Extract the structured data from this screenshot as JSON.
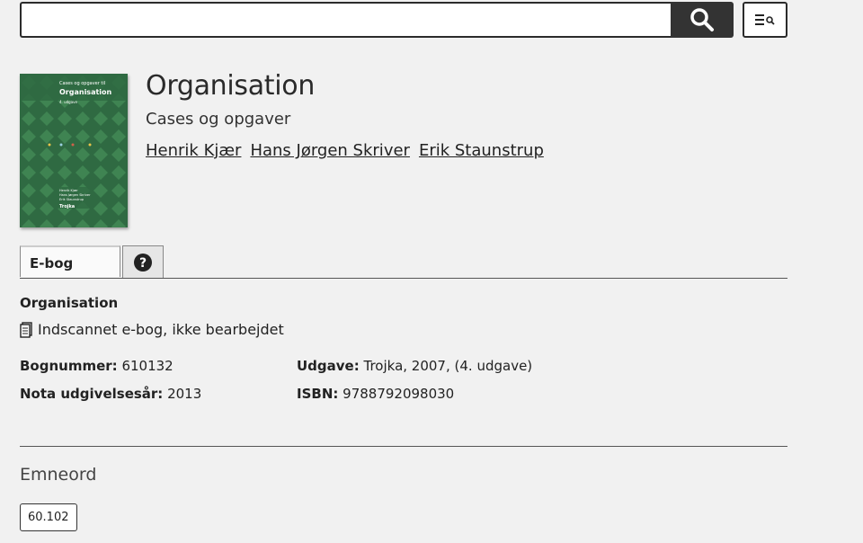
{
  "search": {
    "value": "",
    "placeholder": "",
    "icon": "search-icon",
    "advanced_icon": "advanced-search-icon"
  },
  "book": {
    "title": "Organisation",
    "subtitle": "Cases og opgaver",
    "authors": [
      "Henrik Kjær",
      "Hans Jørgen Skriver",
      "Erik Staunstrup"
    ],
    "cover": {
      "line1": "Cases og opgaver til",
      "line2": "Organisation",
      "line3": "4. udgave",
      "authors_small": [
        "Henrik Kjær",
        "Hans Jørgen Skriver",
        "Erik Staunstrup"
      ],
      "publisher": "Trojka",
      "color": "#2f6a42"
    }
  },
  "tabs": [
    {
      "label": "E-bog",
      "active": true
    },
    {
      "label": "?",
      "icon": "help-icon",
      "active": false
    }
  ],
  "details": {
    "heading": "Organisation",
    "format": "Indscannet e-bog, ikke bearbejdet",
    "format_icon": "document-icon",
    "bognummer_label": "Bognummer:",
    "bognummer": "610132",
    "udgivelsesaar_label": "Nota udgivelsesår:",
    "udgivelsesaar": "2013",
    "udgave_label": "Udgave:",
    "udgave": "Trojka, 2007, (4. udgave)",
    "isbn_label": "ISBN:",
    "isbn": "9788792098030"
  },
  "subjects": {
    "heading": "Emneord",
    "tags": [
      "60.102"
    ]
  }
}
